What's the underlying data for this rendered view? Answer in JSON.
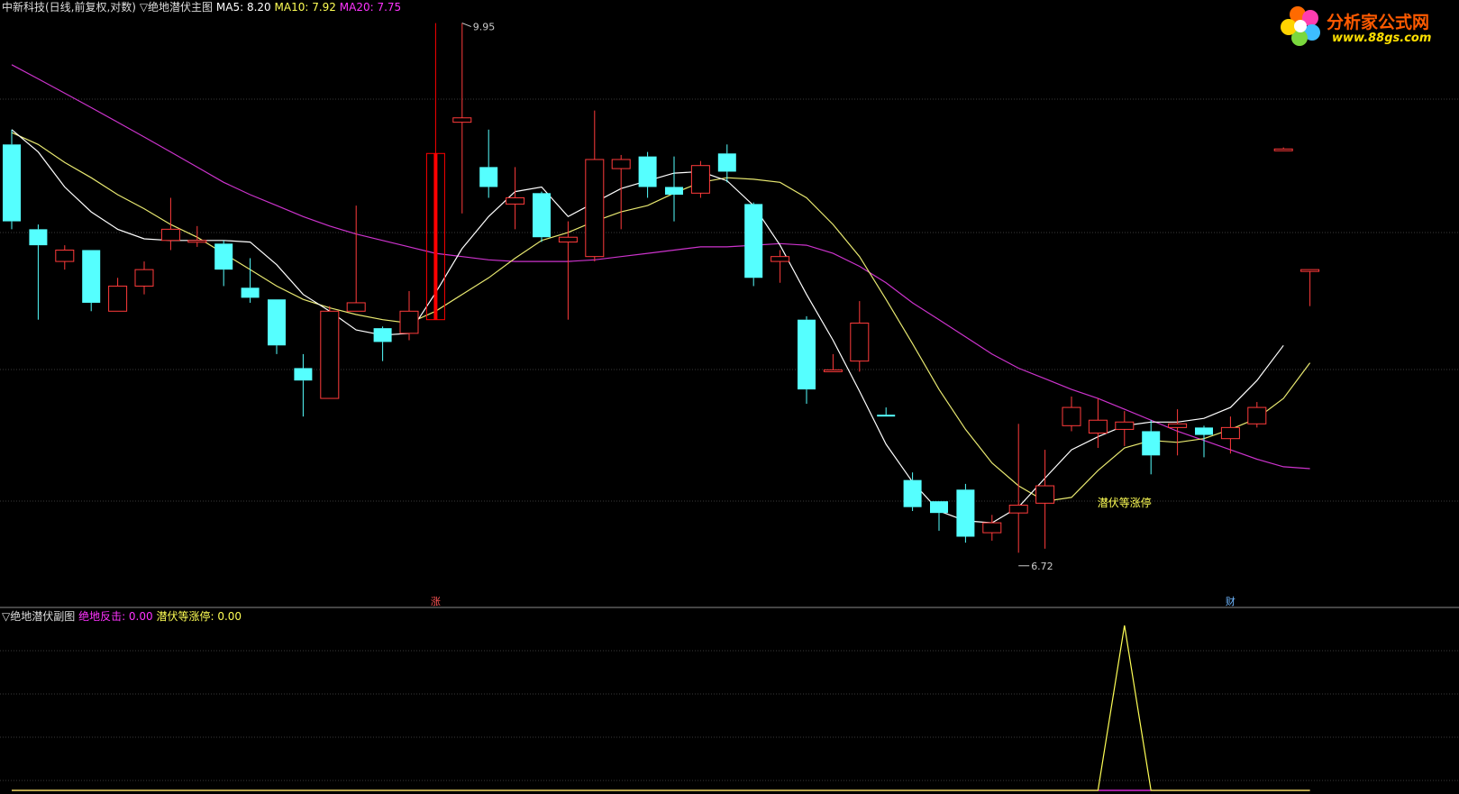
{
  "main_panel": {
    "title": "中新科技(日线,前复权,对数)",
    "indicator_name": "▽绝地潜伏主图",
    "ma_values": [
      {
        "label": "MA5: 8.20",
        "color": "#ffffff"
      },
      {
        "label": "MA10: 7.92",
        "color": "#ffff55"
      },
      {
        "label": "MA20: 7.75",
        "color": "#ff33ff"
      }
    ],
    "high_label": "9.95",
    "low_label": "6.72",
    "signal_text": "潜伏等涨停",
    "limit_up_marker": "涨",
    "finance_marker": "财"
  },
  "sub_panel": {
    "indicator_name": "▽绝地潜伏副图",
    "values": [
      {
        "label": "绝地反击: 0.00",
        "color": "#ff33ff"
      },
      {
        "label": "潜伏等涨停: 0.00",
        "color": "#ffff55"
      }
    ]
  },
  "logo": {
    "name": "分析家公式网",
    "url_text": "www.88gs.com"
  },
  "colors": {
    "up": "#ff3b3b",
    "down": "#55ffff",
    "ma5": "#ffffff",
    "ma10": "#e8e870",
    "ma20": "#cc33cc",
    "grid": "#3a3a3a"
  },
  "chart_data": {
    "type": "candlestick",
    "ylim": [
      6.5,
      10.0
    ],
    "candles": [
      {
        "o": 9.1,
        "h": 9.2,
        "l": 8.55,
        "c": 8.6
      },
      {
        "o": 8.55,
        "h": 8.58,
        "l": 8.0,
        "c": 8.45
      },
      {
        "o": 8.35,
        "h": 8.45,
        "l": 8.3,
        "c": 8.42
      },
      {
        "o": 8.42,
        "h": 8.42,
        "l": 8.05,
        "c": 8.1
      },
      {
        "o": 8.05,
        "h": 8.25,
        "l": 8.05,
        "c": 8.2
      },
      {
        "o": 8.2,
        "h": 8.35,
        "l": 8.15,
        "c": 8.3
      },
      {
        "o": 8.48,
        "h": 8.75,
        "l": 8.42,
        "c": 8.55
      },
      {
        "o": 8.48,
        "h": 8.57,
        "l": 8.44,
        "c": 8.48
      },
      {
        "o": 8.46,
        "h": 8.48,
        "l": 8.2,
        "c": 8.3
      },
      {
        "o": 8.19,
        "h": 8.37,
        "l": 8.1,
        "c": 8.13
      },
      {
        "o": 8.12,
        "h": 8.12,
        "l": 7.8,
        "c": 7.85
      },
      {
        "o": 7.72,
        "h": 7.8,
        "l": 7.45,
        "c": 7.65
      },
      {
        "o": 7.55,
        "h": 8.08,
        "l": 7.55,
        "c": 8.05
      },
      {
        "o": 8.05,
        "h": 8.7,
        "l": 8.05,
        "c": 8.1
      },
      {
        "o": 7.95,
        "h": 7.96,
        "l": 7.76,
        "c": 7.87
      },
      {
        "o": 7.92,
        "h": 8.17,
        "l": 7.88,
        "c": 8.05
      },
      {
        "o": 8.0,
        "h": 9.95,
        "l": 8.0,
        "c": 9.04,
        "limit_up": true
      },
      {
        "o": 9.25,
        "h": 9.95,
        "l": 8.65,
        "c": 9.28
      },
      {
        "o": 8.95,
        "h": 9.2,
        "l": 8.75,
        "c": 8.82
      },
      {
        "o": 8.71,
        "h": 8.95,
        "l": 8.55,
        "c": 8.75
      },
      {
        "o": 8.78,
        "h": 8.79,
        "l": 8.47,
        "c": 8.5
      },
      {
        "o": 8.47,
        "h": 8.6,
        "l": 8.0,
        "c": 8.5
      },
      {
        "o": 8.38,
        "h": 9.33,
        "l": 8.35,
        "c": 9.0
      },
      {
        "o": 8.94,
        "h": 9.03,
        "l": 8.55,
        "c": 9.0
      },
      {
        "o": 9.02,
        "h": 9.05,
        "l": 8.75,
        "c": 8.82
      },
      {
        "o": 8.82,
        "h": 9.02,
        "l": 8.6,
        "c": 8.77
      },
      {
        "o": 8.78,
        "h": 8.99,
        "l": 8.75,
        "c": 8.96
      },
      {
        "o": 9.04,
        "h": 9.1,
        "l": 8.85,
        "c": 8.92
      },
      {
        "o": 8.71,
        "h": 8.72,
        "l": 8.2,
        "c": 8.25
      },
      {
        "o": 8.35,
        "h": 8.42,
        "l": 8.22,
        "c": 8.38
      },
      {
        "o": 8.0,
        "h": 8.02,
        "l": 7.52,
        "c": 7.6
      },
      {
        "o": 7.71,
        "h": 7.8,
        "l": 7.7,
        "c": 7.71
      },
      {
        "o": 7.76,
        "h": 8.11,
        "l": 7.7,
        "c": 7.98
      },
      {
        "o": 7.46,
        "h": 7.5,
        "l": 7.45,
        "c": 7.45
      },
      {
        "o": 7.11,
        "h": 7.15,
        "l": 6.95,
        "c": 6.97
      },
      {
        "o": 7.0,
        "h": 7.0,
        "l": 6.85,
        "c": 6.94
      },
      {
        "o": 7.06,
        "h": 7.09,
        "l": 6.79,
        "c": 6.82
      },
      {
        "o": 6.84,
        "h": 6.93,
        "l": 6.8,
        "c": 6.89
      },
      {
        "o": 6.94,
        "h": 7.41,
        "l": 6.74,
        "c": 6.98
      },
      {
        "o": 6.99,
        "h": 7.27,
        "l": 6.76,
        "c": 7.08
      },
      {
        "o": 7.4,
        "h": 7.56,
        "l": 7.37,
        "c": 7.5
      },
      {
        "o": 7.36,
        "h": 7.55,
        "l": 7.28,
        "c": 7.43
      },
      {
        "o": 7.38,
        "h": 7.48,
        "l": 7.29,
        "c": 7.42
      },
      {
        "o": 7.37,
        "h": 7.43,
        "l": 7.14,
        "c": 7.24
      },
      {
        "o": 7.39,
        "h": 7.49,
        "l": 7.24,
        "c": 7.41
      },
      {
        "o": 7.39,
        "h": 7.4,
        "l": 7.23,
        "c": 7.35
      },
      {
        "o": 7.33,
        "h": 7.45,
        "l": 7.25,
        "c": 7.39
      },
      {
        "o": 7.41,
        "h": 7.53,
        "l": 7.39,
        "c": 7.5
      },
      {
        "o": 9.07,
        "h": 9.08,
        "l": 9.06,
        "c": 9.07
      },
      {
        "o": 8.3,
        "h": 8.3,
        "l": 8.08,
        "c": 8.3
      }
    ],
    "ma5": [
      9.2,
      9.05,
      8.82,
      8.66,
      8.55,
      8.49,
      8.48,
      8.48,
      8.48,
      8.47,
      8.33,
      8.15,
      8.05,
      7.94,
      7.91,
      7.92,
      8.16,
      8.43,
      8.63,
      8.79,
      8.82,
      8.63,
      8.72,
      8.81,
      8.86,
      8.91,
      8.92,
      8.86,
      8.7,
      8.45,
      8.15,
      7.88,
      7.59,
      7.3,
      7.1,
      6.95,
      6.9,
      6.89,
      6.97,
      7.12,
      7.27,
      7.34,
      7.4,
      7.42,
      7.42,
      7.44,
      7.5,
      7.65,
      7.85
    ],
    "ma10": [
      9.18,
      9.1,
      8.98,
      8.88,
      8.77,
      8.68,
      8.58,
      8.5,
      8.4,
      8.3,
      8.2,
      8.12,
      8.07,
      8.03,
      8.0,
      7.98,
      8.05,
      8.15,
      8.25,
      8.37,
      8.48,
      8.53,
      8.6,
      8.66,
      8.7,
      8.78,
      8.85,
      8.88,
      8.87,
      8.85,
      8.75,
      8.58,
      8.38,
      8.12,
      7.86,
      7.6,
      7.38,
      7.2,
      7.08,
      7.0,
      7.02,
      7.16,
      7.28,
      7.32,
      7.31,
      7.33,
      7.38,
      7.44,
      7.55,
      7.75
    ],
    "ma20": [
      9.65,
      9.55,
      9.45,
      9.35,
      9.25,
      9.15,
      9.05,
      8.95,
      8.85,
      8.77,
      8.7,
      8.63,
      8.57,
      8.52,
      8.48,
      8.44,
      8.4,
      8.38,
      8.36,
      8.35,
      8.35,
      8.35,
      8.36,
      8.38,
      8.4,
      8.42,
      8.44,
      8.44,
      8.45,
      8.46,
      8.45,
      8.4,
      8.32,
      8.22,
      8.1,
      8.0,
      7.9,
      7.8,
      7.72,
      7.66,
      7.6,
      7.55,
      7.49,
      7.43,
      7.37,
      7.32,
      7.27,
      7.22,
      7.18,
      7.17
    ],
    "sub_series_jiedi_fanji": [
      0,
      0,
      0,
      0,
      0,
      0,
      0,
      0,
      0,
      0,
      0,
      0,
      0,
      0,
      0,
      0,
      0,
      0,
      0,
      0,
      0,
      0,
      0,
      0,
      0,
      0,
      0,
      0,
      0,
      0,
      0,
      0,
      0,
      0,
      0,
      0,
      0,
      0,
      0,
      0,
      0,
      0,
      0,
      0,
      0,
      0,
      0,
      0,
      0,
      0
    ],
    "sub_series_qianfu": [
      0,
      0,
      0,
      0,
      0,
      0,
      0,
      0,
      0,
      0,
      0,
      0,
      0,
      0,
      0,
      0,
      0,
      0,
      0,
      0,
      0,
      0,
      0,
      0,
      0,
      0,
      0,
      0,
      0,
      0,
      0,
      0,
      0,
      0,
      0,
      0,
      0,
      0,
      0,
      0,
      0,
      0,
      1,
      0,
      0,
      0,
      0,
      0,
      0,
      0
    ],
    "sub_ylim": [
      0,
      1
    ]
  }
}
